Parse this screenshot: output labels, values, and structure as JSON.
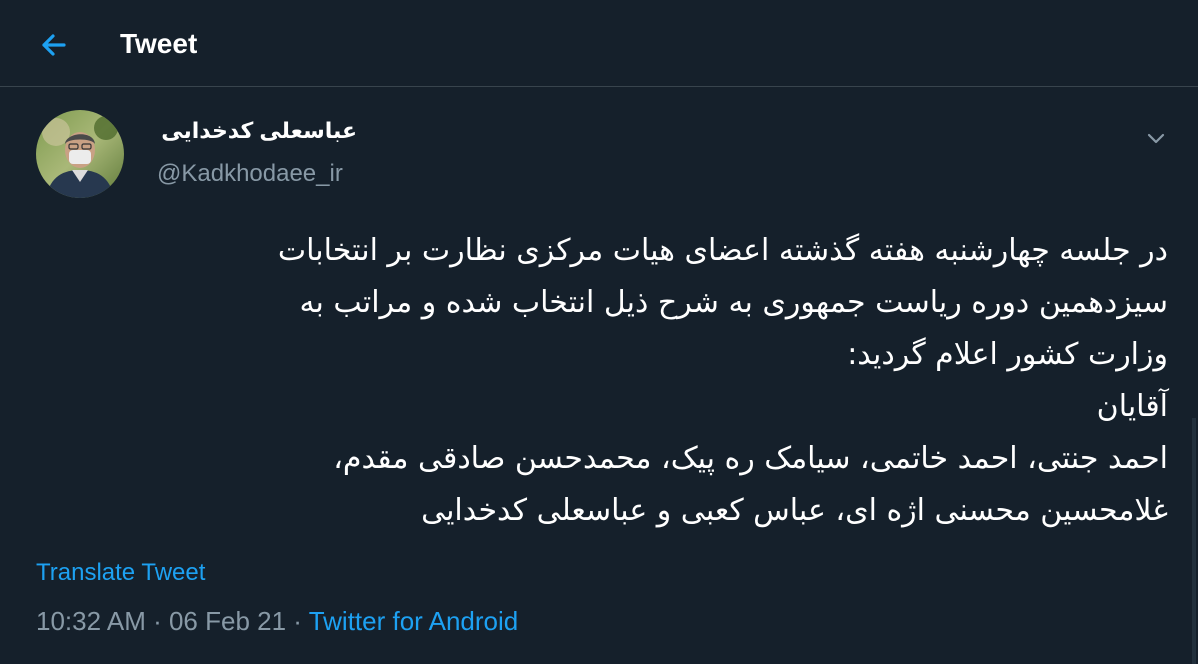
{
  "header": {
    "title": "Tweet",
    "back_icon": "arrow-left-icon"
  },
  "author": {
    "display_name": "عباسعلی کدخدایی",
    "username": "@Kadkhodaee_ir"
  },
  "tweet": {
    "lines": [
      "در جلسه چهارشنبه هفته گذشته اعضای هیات مرکزی نظارت بر انتخابات",
      "سیزدهمین دوره ریاست جمهوری به شرح ذیل انتخاب شده و مراتب به",
      "وزارت کشور اعلام گردید:",
      "آقایان",
      "احمد جنتی، احمد خاتمی، سیامک ره پیک، محمدحسن صادقی مقدم،",
      "غلامحسین محسنی اژه ای، عباس کعبی و عباسعلی کدخدایی"
    ],
    "translate_label": "Translate Tweet",
    "time": "10:32 AM",
    "separator": " · ",
    "date": "06 Feb 21",
    "source": "Twitter for Android"
  },
  "colors": {
    "background": "#15202b",
    "accent": "#1da1f2",
    "secondary_text": "#8899a6",
    "divider": "#38444d"
  }
}
